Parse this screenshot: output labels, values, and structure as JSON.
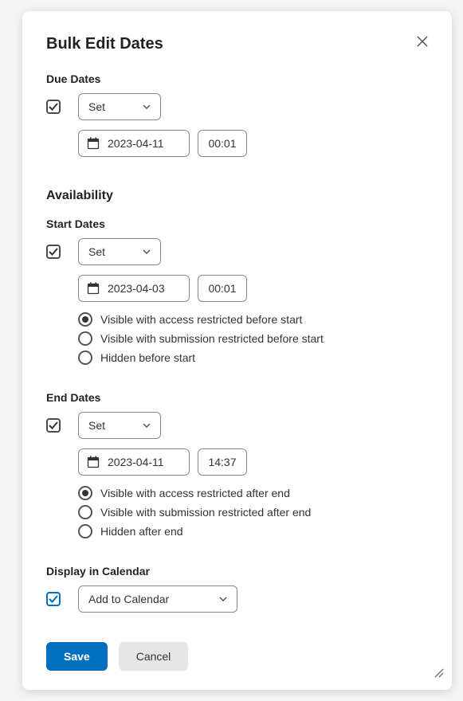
{
  "modal": {
    "title": "Bulk Edit Dates"
  },
  "dueDates": {
    "label": "Due Dates",
    "mode": "Set",
    "date": "2023-04-11",
    "time": "00:01"
  },
  "availability": {
    "heading": "Availability"
  },
  "startDates": {
    "label": "Start Dates",
    "mode": "Set",
    "date": "2023-04-03",
    "time": "00:01",
    "options": {
      "o0": "Visible with access restricted before start",
      "o1": "Visible with submission restricted before start",
      "o2": "Hidden before start"
    }
  },
  "endDates": {
    "label": "End Dates",
    "mode": "Set",
    "date": "2023-04-11",
    "time": "14:37",
    "options": {
      "o0": "Visible with access restricted after end",
      "o1": "Visible with submission restricted after end",
      "o2": "Hidden after end"
    }
  },
  "calendar": {
    "label": "Display in Calendar",
    "mode": "Add to Calendar"
  },
  "buttons": {
    "save": "Save",
    "cancel": "Cancel"
  }
}
